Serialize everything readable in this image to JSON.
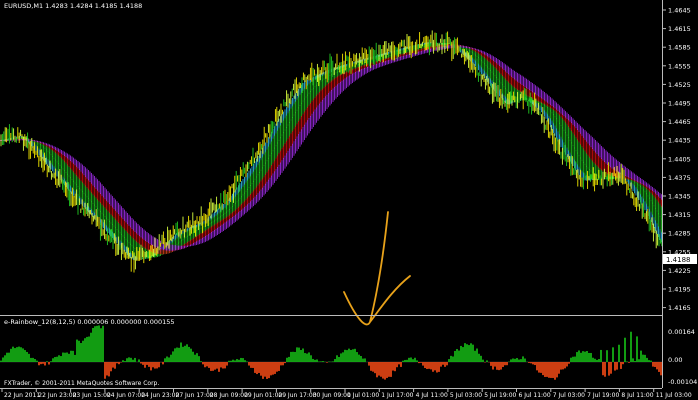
{
  "main_chart": {
    "header": "EURUSD,M1  1.4283 1.4284 1.4185 1.4188",
    "price_ticks": [
      "1.4645",
      "1.4615",
      "1.4585",
      "1.4555",
      "1.4525",
      "1.4495",
      "1.4465",
      "1.4435",
      "1.4405",
      "1.4375",
      "1.4345",
      "1.4315",
      "1.4285",
      "1.4255",
      "1.4225",
      "1.4195",
      "1.4165"
    ],
    "current_price": "1.4188",
    "colors": {
      "background": "#000000",
      "yellow": "#f2e600",
      "cyan": "#33ccff",
      "green": "#22cc22",
      "red": "#e01010",
      "magenta": "#b030ff",
      "orange_annotation": "#e8a21a",
      "current_price_box": "#ffffff"
    }
  },
  "indicator": {
    "header": "e-Rainbow_12(8,12,5) 0.000006 0.000000 0.000155",
    "ticks": [
      "0.00164",
      "0.00",
      "-0.00104"
    ],
    "colors": {
      "positive": "#16c416",
      "negative": "#ff4d17"
    }
  },
  "time_axis": [
    "22 Jun 2011",
    "22 Jun 23:00",
    "23 Jun 15:00",
    "24 Jun 07:00",
    "24 Jun 23:00",
    "27 Jun 17:00",
    "28 Jun 09:00",
    "29 Jun 01:00",
    "29 Jun 17:00",
    "30 Jun 09:00",
    "1 Jul 01:00",
    "1 Jul 17:00",
    "4 Jul 11:00",
    "5 Jul 03:00",
    "5 Jul 19:00",
    "6 Jul 11:00",
    "7 Jul 03:00",
    "7 Jul 19:00",
    "8 Jul 11:00",
    "11 Jul 03:00"
  ],
  "copyright": "FXTrader, © 2001-2011 MetaQuotes Software Corp."
}
